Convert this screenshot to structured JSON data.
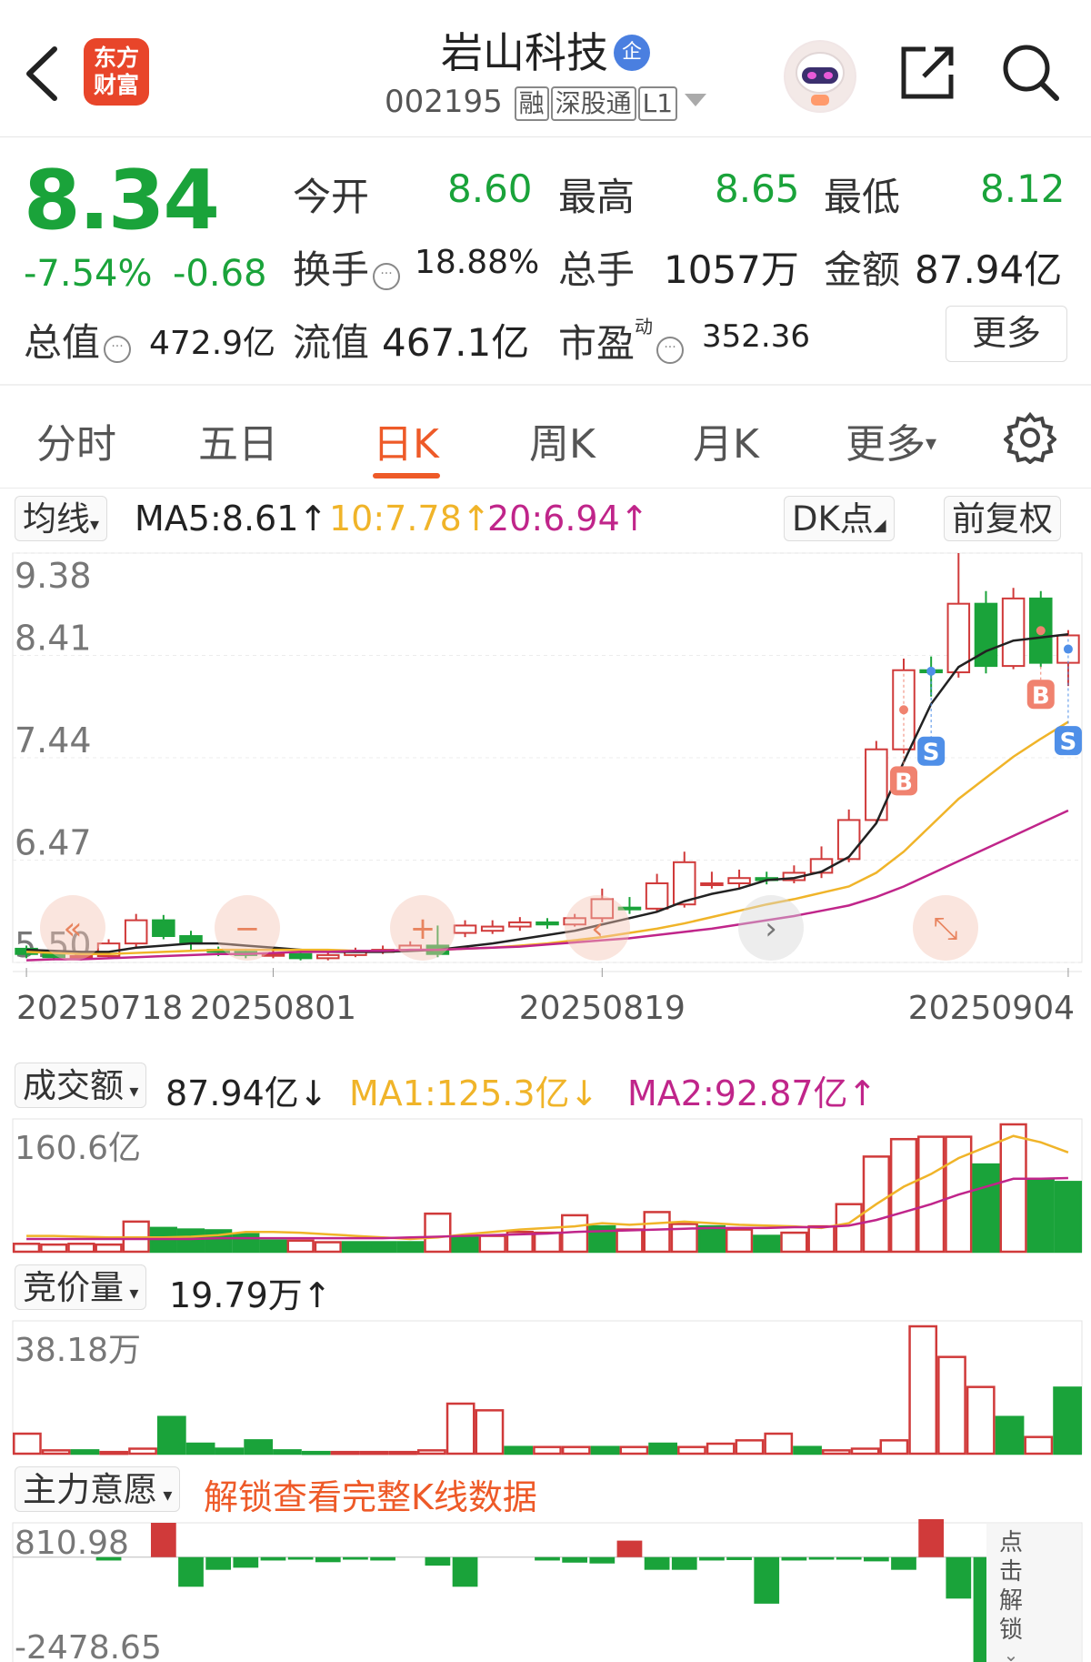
{
  "header": {
    "logo_line1": "东方",
    "logo_line2": "财富",
    "stock_name": "岩山科技",
    "enterprise_badge": "企",
    "stock_code": "002195",
    "tag_rong": "融",
    "tag_sgt": "深股通",
    "tag_level": "L1"
  },
  "quote": {
    "price": "8.34",
    "change_pct": "-7.54%",
    "change_abs": "-0.68",
    "open_label": "今开",
    "open_value": "8.60",
    "high_label": "最高",
    "high_value": "8.65",
    "low_label": "最低",
    "low_value": "8.12",
    "turnover_label": "换手",
    "turnover_value": "18.88%",
    "volume_label": "总手",
    "volume_value": "1057万",
    "amount_label": "金额",
    "amount_value": "87.94亿",
    "mktcap_label": "总值",
    "mktcap_value": "472.9亿",
    "float_label": "流值",
    "float_value": "467.1亿",
    "pe_label": "市盈",
    "pe_sup": "动",
    "pe_value": "352.36",
    "more_button": "更多",
    "dots_glyph": "···"
  },
  "tabs": [
    "分时",
    "五日",
    "日K",
    "周K",
    "月K",
    "更多"
  ],
  "active_tab": 2,
  "kline": {
    "indicator_select": "均线",
    "ma5": "MA5:8.61↑",
    "ma10": "10:7.78↑",
    "ma20": "20:6.94↑",
    "dk_button": "DK点",
    "adjust_button": "前复权",
    "y_labels": [
      "9.38",
      "8.41",
      "7.44",
      "6.47",
      "5.50"
    ],
    "x_labels": [
      "20250718",
      "20250801",
      "20250819",
      "20250904"
    ],
    "colors": {
      "up": "#d03a3a",
      "down": "#1aa33a",
      "ma5": "#222222",
      "ma10": "#f0b429",
      "ma20": "#c0258a"
    }
  },
  "chart_data": [
    {
      "type": "candlestick",
      "title": "",
      "ylim": [
        5.5,
        9.38
      ],
      "x": [
        "20250718",
        "",
        "",
        "",
        "",
        "",
        "",
        "",
        "",
        "20250801",
        "",
        "",
        "",
        "",
        "",
        "",
        "",
        "",
        "",
        "",
        "",
        "20250819",
        "",
        "",
        "",
        "",
        "",
        "",
        "",
        "",
        "",
        "",
        "20250904"
      ],
      "open": [
        5.63,
        5.58,
        5.55,
        5.56,
        5.68,
        5.9,
        5.75,
        5.62,
        5.6,
        5.57,
        5.58,
        5.54,
        5.57,
        5.6,
        5.62,
        5.66,
        5.78,
        5.8,
        5.84,
        5.88,
        5.86,
        5.92,
        6.02,
        6.01,
        6.05,
        6.25,
        6.25,
        6.3,
        6.28,
        6.35,
        6.48,
        6.85,
        7.52,
        8.27,
        8.25,
        8.9,
        8.31,
        8.95,
        8.34
      ],
      "close": [
        5.58,
        5.55,
        5.56,
        5.68,
        5.9,
        5.75,
        5.68,
        5.6,
        5.57,
        5.58,
        5.54,
        5.57,
        5.6,
        5.62,
        5.66,
        5.58,
        5.85,
        5.84,
        5.88,
        5.86,
        5.92,
        6.1,
        6.01,
        6.25,
        6.45,
        6.25,
        6.3,
        6.28,
        6.35,
        6.48,
        6.85,
        7.52,
        8.27,
        8.25,
        8.9,
        8.31,
        8.95,
        8.34,
        8.6
      ],
      "high": [
        5.66,
        5.62,
        5.6,
        5.72,
        5.96,
        5.95,
        5.8,
        5.65,
        5.63,
        5.62,
        5.61,
        5.62,
        5.64,
        5.66,
        5.7,
        5.85,
        5.9,
        5.9,
        5.93,
        5.92,
        5.96,
        6.2,
        6.12,
        6.34,
        6.55,
        6.36,
        6.38,
        6.36,
        6.42,
        6.6,
        6.95,
        7.6,
        8.38,
        8.4,
        9.38,
        9.02,
        9.05,
        9.02,
        8.65
      ],
      "low": [
        5.54,
        5.52,
        5.52,
        5.54,
        5.64,
        5.72,
        5.6,
        5.56,
        5.54,
        5.54,
        5.52,
        5.52,
        5.55,
        5.58,
        5.6,
        5.55,
        5.74,
        5.77,
        5.8,
        5.82,
        5.84,
        5.88,
        5.96,
        5.98,
        6.02,
        6.2,
        6.2,
        6.24,
        6.25,
        6.3,
        6.45,
        6.82,
        7.48,
        8.02,
        8.2,
        8.24,
        8.28,
        8.3,
        8.12
      ],
      "series": [
        {
          "name": "MA5",
          "values": [
            5.62,
            5.61,
            5.6,
            5.6,
            5.64,
            5.66,
            5.68,
            5.68,
            5.66,
            5.64,
            5.62,
            5.6,
            5.6,
            5.6,
            5.61,
            5.62,
            5.65,
            5.68,
            5.72,
            5.76,
            5.8,
            5.86,
            5.92,
            5.98,
            6.08,
            6.15,
            6.2,
            6.28,
            6.3,
            6.36,
            6.5,
            6.82,
            7.4,
            7.95,
            8.3,
            8.45,
            8.55,
            8.58,
            8.61
          ]
        },
        {
          "name": "10",
          "values": [
            5.6,
            5.59,
            5.58,
            5.58,
            5.59,
            5.6,
            5.61,
            5.62,
            5.62,
            5.62,
            5.62,
            5.62,
            5.61,
            5.61,
            5.62,
            5.62,
            5.63,
            5.64,
            5.66,
            5.68,
            5.71,
            5.74,
            5.78,
            5.82,
            5.87,
            5.93,
            5.99,
            6.05,
            6.1,
            6.16,
            6.22,
            6.35,
            6.55,
            6.8,
            7.05,
            7.25,
            7.45,
            7.62,
            7.78
          ]
        },
        {
          "name": "20",
          "values": [
            5.52,
            5.53,
            5.53,
            5.54,
            5.55,
            5.56,
            5.57,
            5.58,
            5.58,
            5.59,
            5.6,
            5.6,
            5.61,
            5.61,
            5.62,
            5.62,
            5.63,
            5.64,
            5.65,
            5.67,
            5.69,
            5.71,
            5.73,
            5.76,
            5.79,
            5.82,
            5.86,
            5.9,
            5.94,
            5.99,
            6.04,
            6.12,
            6.22,
            6.34,
            6.46,
            6.58,
            6.7,
            6.82,
            6.94
          ]
        }
      ],
      "signals": [
        {
          "index": 32,
          "mark": "B"
        },
        {
          "index": 33,
          "mark": "S"
        },
        {
          "index": 37,
          "mark": "B"
        },
        {
          "index": 38,
          "mark": "S"
        }
      ]
    },
    {
      "type": "bar",
      "title": "成交额",
      "ymax_label": "160.6亿",
      "ylim": [
        0,
        160.6
      ],
      "values": [
        10,
        9,
        10,
        9,
        38,
        30,
        28,
        27,
        22,
        14,
        14,
        12,
        12,
        12,
        12,
        48,
        18,
        20,
        25,
        24,
        46,
        32,
        28,
        50,
        35,
        32,
        28,
        20,
        24,
        32,
        60,
        120,
        142,
        145,
        145,
        110,
        160.6,
        92,
        87.94
      ],
      "up": [
        1,
        1,
        1,
        1,
        1,
        0,
        0,
        0,
        0,
        0,
        1,
        1,
        0,
        0,
        0,
        1,
        0,
        1,
        1,
        1,
        1,
        0,
        1,
        1,
        1,
        0,
        1,
        0,
        1,
        1,
        1,
        1,
        1,
        1,
        1,
        0,
        1,
        0,
        0
      ],
      "series": [
        {
          "name": "MA1",
          "values": [
            20,
            20,
            19,
            18,
            18,
            18,
            19,
            21,
            25,
            25,
            24,
            22,
            20,
            18,
            16,
            18,
            22,
            25,
            28,
            30,
            32,
            36,
            34,
            36,
            38,
            36,
            34,
            33,
            32,
            30,
            36,
            60,
            82,
            98,
            118,
            132,
            146,
            138,
            125.3
          ]
        },
        {
          "name": "MA2",
          "values": [
            16,
            16,
            16,
            16,
            16,
            16,
            16,
            17,
            17,
            17,
            17,
            17,
            17,
            17,
            18,
            19,
            20,
            21,
            22,
            23,
            25,
            26,
            27,
            28,
            29,
            30,
            30,
            30,
            31,
            31,
            33,
            40,
            50,
            60,
            72,
            82,
            92,
            92,
            92.87
          ]
        }
      ],
      "ma_labels": {
        "current": "87.94亿↓",
        "ma1": "MA1:125.3亿↓",
        "ma2": "MA2:92.87亿↑"
      }
    },
    {
      "type": "bar",
      "title": "竞价量",
      "ymax_label": "38.18万",
      "ylim": [
        0,
        38.18
      ],
      "current_label": "19.79万↑",
      "values": [
        6,
        1,
        1,
        0.5,
        1.5,
        11,
        3,
        1.5,
        4,
        1,
        0.5,
        0.5,
        0.5,
        0.5,
        1,
        15,
        13,
        2,
        2,
        2,
        2,
        2,
        3,
        2,
        3,
        4,
        6,
        2,
        1,
        1.5,
        4,
        38.18,
        29,
        20,
        11,
        5,
        19.79
      ],
      "up": [
        1,
        1,
        0,
        1,
        1,
        0,
        0,
        0,
        0,
        0,
        0,
        1,
        1,
        1,
        1,
        1,
        1,
        0,
        1,
        1,
        0,
        1,
        0,
        1,
        1,
        1,
        1,
        0,
        1,
        1,
        1,
        1,
        1,
        1,
        0,
        1,
        0
      ]
    },
    {
      "type": "bar",
      "title": "主力意愿",
      "ymax_label": "810.98",
      "ymin_label": "-2478.65",
      "ylim": [
        -2478.65,
        810.98
      ],
      "unlock_text": "解锁查看完整K线数据",
      "unlock_side": "点击解锁",
      "values": [
        0,
        0,
        0,
        -80,
        0,
        810.98,
        -700,
        -300,
        -250,
        -80,
        -60,
        -120,
        -60,
        -80,
        0,
        -200,
        -700,
        0,
        0,
        -80,
        -130,
        -150,
        390,
        -300,
        -300,
        -80,
        -70,
        -1100,
        -80,
        -60,
        -60,
        -100,
        -300,
        900,
        -980,
        -2478.65
      ]
    }
  ],
  "nav_buttons": {
    "first": "«",
    "minus": "−",
    "plus": "+",
    "prev": "‹",
    "next": "›",
    "expand": "⤡"
  }
}
